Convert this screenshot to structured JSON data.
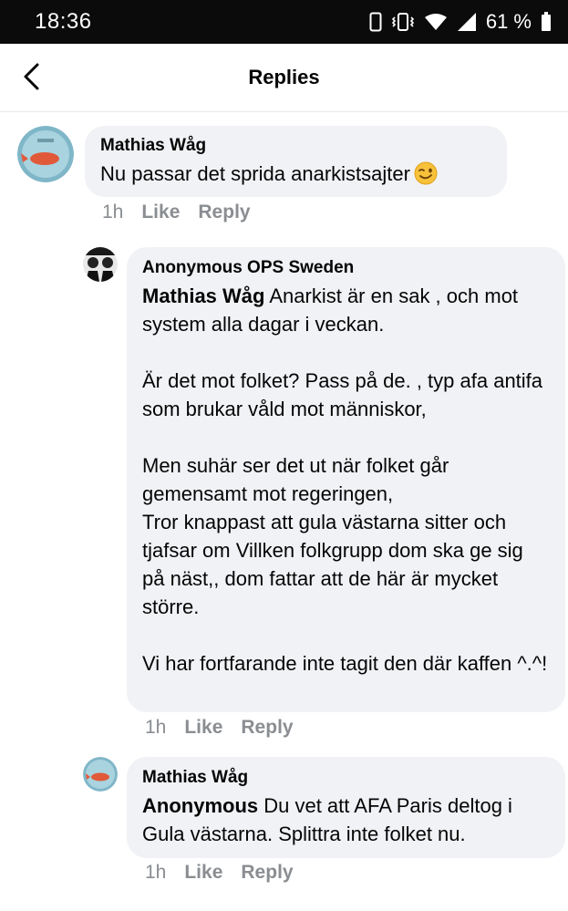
{
  "status_bar": {
    "time": "18:36",
    "battery": "61 %"
  },
  "header": {
    "title": "Replies"
  },
  "comments": [
    {
      "author": "Mathias Wåg",
      "text": "Nu passar det sprida anarkistsajter",
      "emoji": "winking-face",
      "time": "1h",
      "like": "Like",
      "reply": "Reply"
    },
    {
      "author": "Anonymous OPS Sweden",
      "mention": "Mathias Wåg",
      "p1_rest": " Anarkist är en sak , och mot system alla dagar i veckan.",
      "p2": "Är det mot folket? Pass på de. , typ afa antifa som brukar våld mot människor,",
      "p3a": "Men suhär ser det ut när folket går gemensamt mot regeringen,",
      "p3b": "Tror knappast att gula västarna sitter och tjafsar om Villken folkgrupp dom ska ge sig på näst,, dom fattar att de här är mycket större.",
      "p4": "Vi har fortfarande inte tagit den där kaffen ^.^!",
      "time": "1h",
      "like": "Like",
      "reply": "Reply"
    },
    {
      "author": "Mathias Wåg",
      "mention": "Anonymous",
      "rest": " Du vet att AFA Paris deltog i Gula västarna. Splittra inte folket nu.",
      "time": "1h",
      "like": "Like",
      "reply": "Reply"
    }
  ],
  "colors": {
    "bubble": "#f0f2f5",
    "meta": "#8a8d91",
    "status_bar": "#0b0b0b"
  }
}
